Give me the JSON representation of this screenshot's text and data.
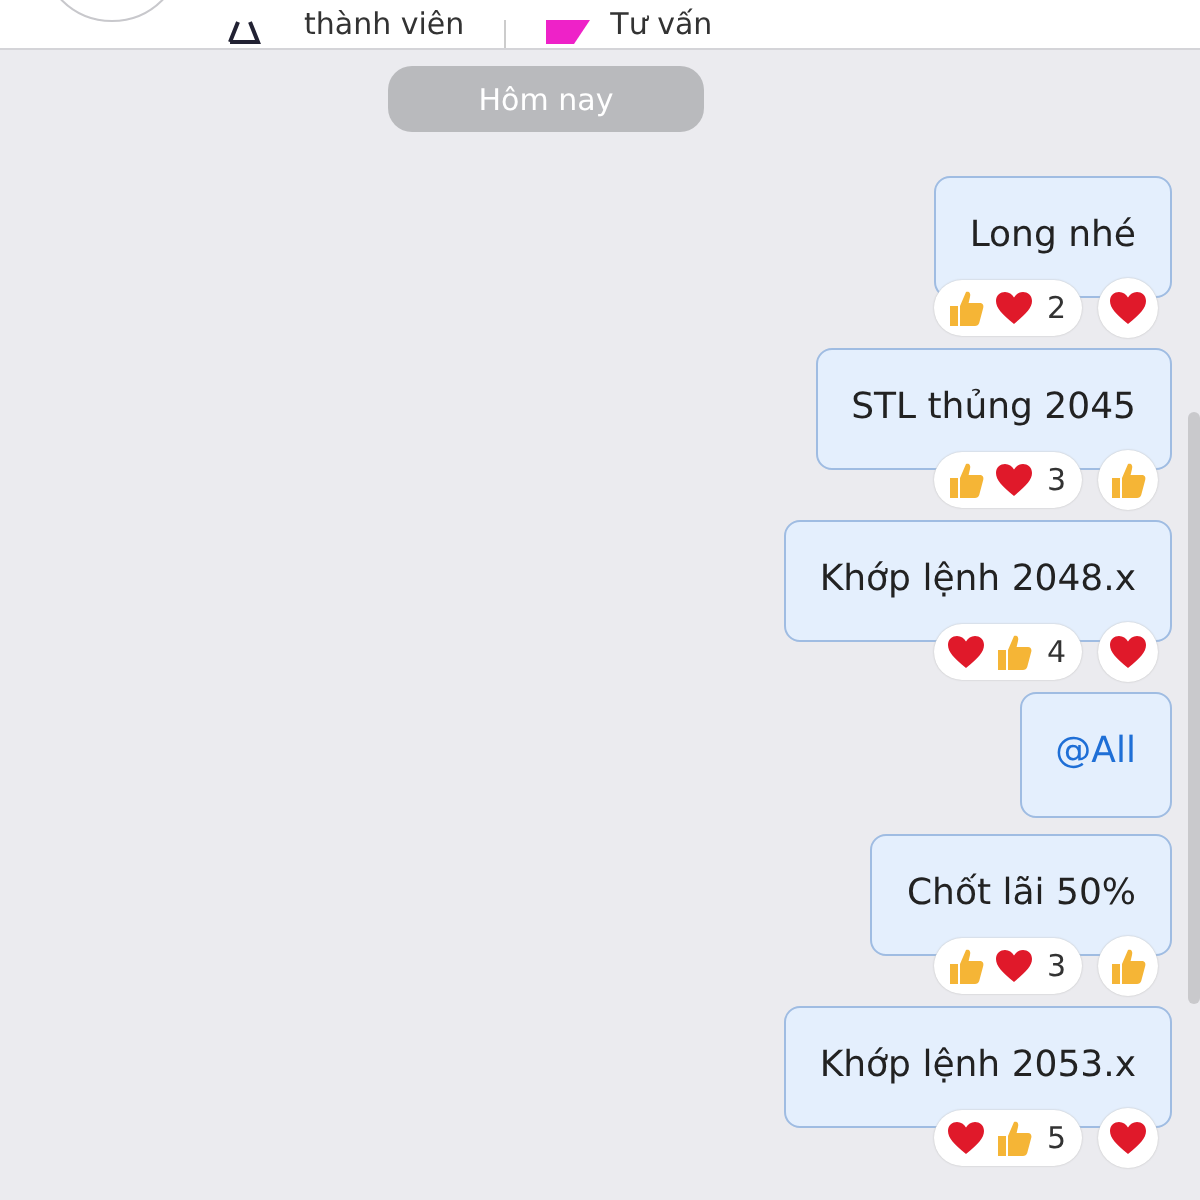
{
  "header": {
    "members_label": "thành viên",
    "consult_label": "Tư vấn"
  },
  "date_label": "Hôm nay",
  "messages": [
    {
      "kind": "text",
      "text": "Long nhé",
      "reactions": [
        {
          "kind": "like"
        },
        {
          "kind": "heart"
        }
      ],
      "count": "2",
      "my_reaction": {
        "kind": "heart"
      }
    },
    {
      "kind": "text",
      "text": "STL thủng 2045",
      "reactions": [
        {
          "kind": "like"
        },
        {
          "kind": "heart"
        }
      ],
      "count": "3",
      "my_reaction": {
        "kind": "like"
      }
    },
    {
      "kind": "text",
      "text": "Khớp lệnh 2048.x",
      "reactions": [
        {
          "kind": "heart"
        },
        {
          "kind": "like"
        }
      ],
      "count": "4",
      "my_reaction": {
        "kind": "heart"
      }
    },
    {
      "kind": "mention",
      "text": "@All"
    },
    {
      "kind": "text",
      "text": "Chốt lãi 50%",
      "reactions": [
        {
          "kind": "like"
        },
        {
          "kind": "heart"
        }
      ],
      "count": "3",
      "my_reaction": {
        "kind": "like"
      }
    },
    {
      "kind": "text",
      "text": "Khớp lệnh 2053.x",
      "reactions": [
        {
          "kind": "heart"
        },
        {
          "kind": "like"
        }
      ],
      "count": "5",
      "my_reaction": {
        "kind": "heart"
      }
    }
  ]
}
